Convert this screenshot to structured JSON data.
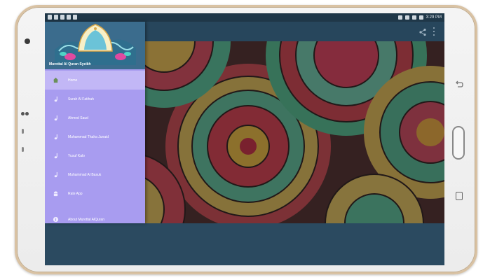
{
  "status_bar": {
    "time": "3:29 PM"
  },
  "drawer": {
    "header_title": "Murottal Al Quran Syeikh",
    "items": [
      {
        "label": "Home",
        "icon": "home-icon",
        "active": true
      },
      {
        "label": "Surah Al Fatihah",
        "icon": "music-note-icon",
        "active": false
      },
      {
        "label": "Ahmed Saud",
        "icon": "music-note-icon",
        "active": false
      },
      {
        "label": "Muhammad Thaha Junaid",
        "icon": "music-note-icon",
        "active": false
      },
      {
        "label": "Yusuf Kalo",
        "icon": "music-note-icon",
        "active": false
      },
      {
        "label": "Muhammad Al Basuk",
        "icon": "music-note-icon",
        "active": false
      },
      {
        "label": "Rate App",
        "icon": "android-icon",
        "active": false
      },
      {
        "label": "About Murottal AlQuran",
        "icon": "info-icon",
        "active": false
      }
    ]
  },
  "colors": {
    "drawer_bg": "#a89cf0",
    "drawer_active": "#c2b7f6",
    "appbar": "#27465c",
    "status_bar": "#1f3748"
  }
}
